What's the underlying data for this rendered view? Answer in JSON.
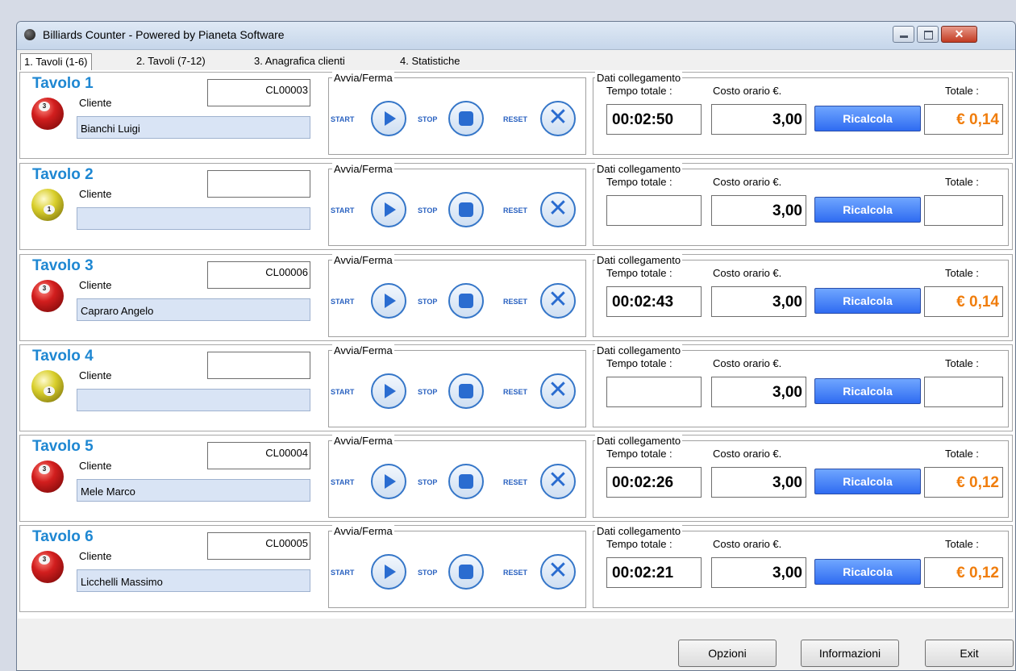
{
  "window": {
    "title": "Billiards Counter - Powered by Pianeta Software"
  },
  "tabs": [
    {
      "label": "1. Tavoli (1-6)",
      "active": true
    },
    {
      "label": "2. Tavoli (7-12)",
      "active": false
    },
    {
      "label": "3. Anagrafica clienti",
      "active": false
    },
    {
      "label": "4. Statistiche",
      "active": false
    }
  ],
  "labels": {
    "cliente": "Cliente",
    "avvia_ferma": "Avvia/Ferma",
    "start": "START",
    "stop": "STOP",
    "reset": "RESET",
    "dati_collegamento": "Dati collegamento",
    "tempo_totale": "Tempo totale :",
    "costo_orario": "Costo orario €.",
    "totale": "Totale :",
    "ricalcola": "Ricalcola"
  },
  "tables": [
    {
      "name": "Tavolo 1",
      "ball": "red-3-ball-icon",
      "ball_number": "3",
      "client_code": "CL00003",
      "client_name": "Bianchi  Luigi",
      "time": "00:02:50",
      "cost": "3,00",
      "total": "€ 0,14"
    },
    {
      "name": "Tavolo 2",
      "ball": "yellow-1-ball-icon",
      "ball_number": "1",
      "client_code": "",
      "client_name": "",
      "time": "",
      "cost": "3,00",
      "total": ""
    },
    {
      "name": "Tavolo 3",
      "ball": "red-3-ball-icon",
      "ball_number": "3",
      "client_code": "CL00006",
      "client_name": "Capraro Angelo",
      "time": "00:02:43",
      "cost": "3,00",
      "total": "€ 0,14"
    },
    {
      "name": "Tavolo 4",
      "ball": "yellow-1-ball-icon",
      "ball_number": "1",
      "client_code": "",
      "client_name": "",
      "time": "",
      "cost": "3,00",
      "total": ""
    },
    {
      "name": "Tavolo 5",
      "ball": "red-3-ball-icon",
      "ball_number": "3",
      "client_code": "CL00004",
      "client_name": "Mele Marco",
      "time": "00:02:26",
      "cost": "3,00",
      "total": "€ 0,12"
    },
    {
      "name": "Tavolo 6",
      "ball": "red-3-ball-icon",
      "ball_number": "3",
      "client_code": "CL00005",
      "client_name": "Licchelli Massimo",
      "time": "00:02:21",
      "cost": "3,00",
      "total": "€ 0,12"
    }
  ],
  "footer": {
    "opzioni": "Opzioni",
    "informazioni": "Informazioni",
    "exit": "Exit"
  },
  "colors": {
    "table_title": "#1e87d2",
    "total_text": "#f07d0c",
    "ricalcola_bg": "#2f6bf1",
    "client_field_bg": "#d9e4f5"
  }
}
